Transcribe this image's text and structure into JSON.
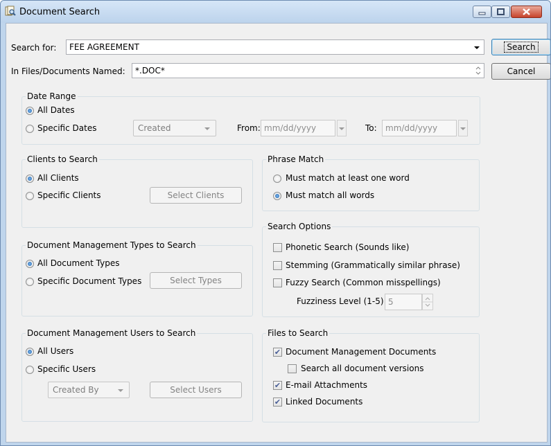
{
  "window": {
    "title": "Document Search"
  },
  "search": {
    "search_for_label": "Search for:",
    "search_for_value": "FEE AGREEMENT",
    "files_named_label": "In Files/Documents Named:",
    "files_named_value": "*.DOC*"
  },
  "buttons": {
    "search": "Search",
    "cancel": "Cancel"
  },
  "date_range": {
    "legend": "Date Range",
    "all_dates": "All Dates",
    "specific_dates": "Specific Dates",
    "date_type_selected": "Created",
    "from_label": "From:",
    "from_placeholder": "mm/dd/yyyy",
    "to_label": "To:",
    "to_placeholder": "mm/dd/yyyy"
  },
  "clients": {
    "legend": "Clients to Search",
    "all": "All Clients",
    "specific": "Specific Clients",
    "select_button": "Select Clients"
  },
  "doc_types": {
    "legend": "Document Management Types to Search",
    "all": "All Document Types",
    "specific": "Specific Document Types",
    "select_button": "Select Types"
  },
  "users": {
    "legend": "Document Management Users to Search",
    "all": "All Users",
    "specific": "Specific Users",
    "user_filter_selected": "Created By",
    "select_button": "Select Users"
  },
  "phrase_match": {
    "legend": "Phrase Match",
    "one_word": "Must match at least one word",
    "all_words": "Must match all words"
  },
  "search_options": {
    "legend": "Search Options",
    "phonetic": "Phonetic Search (Sounds like)",
    "stemming": "Stemming (Grammatically similar phrase)",
    "fuzzy": "Fuzzy Search (Common misspellings)",
    "fuzziness_label": "Fuzziness Level (1-5)",
    "fuzziness_value": "5"
  },
  "files_to_search": {
    "legend": "Files to Search",
    "dm_documents": "Document Management Documents",
    "all_versions": "Search all document versions",
    "email_attachments": "E-mail Attachments",
    "linked_documents": "Linked Documents"
  },
  "colors": {
    "title_bar": "#bcd3ec",
    "dialog_bg": "#f0f0f0",
    "close_button": "#c7432b"
  }
}
